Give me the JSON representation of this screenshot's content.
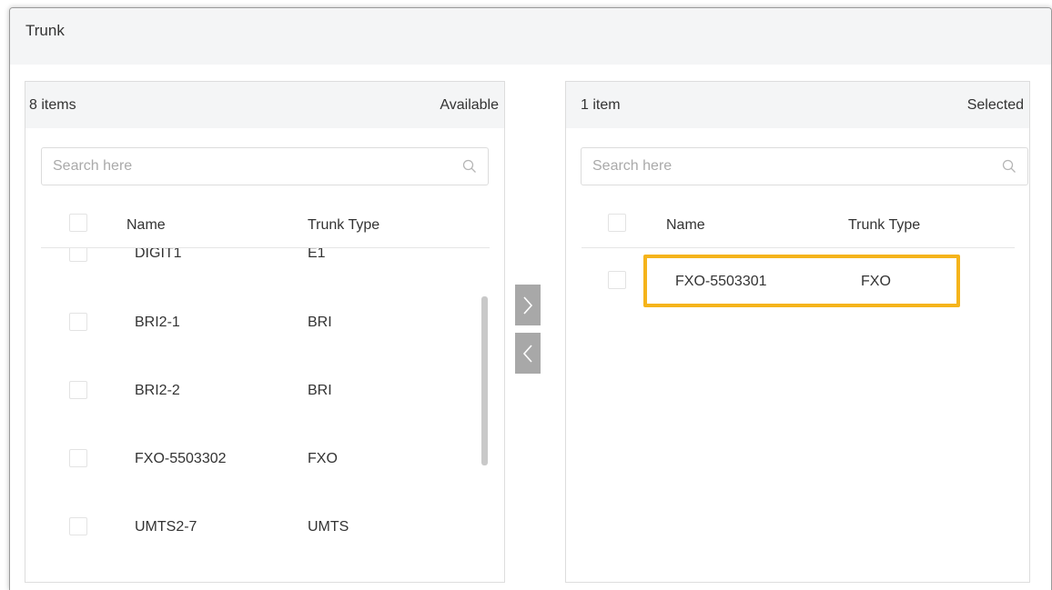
{
  "header": {
    "title": "Trunk"
  },
  "available": {
    "count_label": "8 items",
    "panel_label": "Available",
    "search_placeholder": "Search here",
    "columns": [
      "Name",
      "Trunk Type"
    ],
    "rows": [
      {
        "name": "DIGIT1",
        "type": "E1"
      },
      {
        "name": "BRI2-1",
        "type": "BRI"
      },
      {
        "name": "BRI2-2",
        "type": "BRI"
      },
      {
        "name": "FXO-5503302",
        "type": "FXO"
      },
      {
        "name": "UMTS2-7",
        "type": "UMTS"
      }
    ]
  },
  "selected": {
    "count_label": "1 item",
    "panel_label": "Selected",
    "search_placeholder": "Search here",
    "columns": [
      "Name",
      "Trunk Type"
    ],
    "rows": [
      {
        "name": "FXO-5503301",
        "type": "FXO"
      }
    ]
  },
  "icons": {
    "search": "search-icon",
    "move_right": "chevron-right-icon",
    "move_left": "chevron-left-icon"
  },
  "colors": {
    "highlight": "#f5b41b",
    "transfer_button": "#a8a8a8",
    "header_bg": "#f4f5f6"
  }
}
